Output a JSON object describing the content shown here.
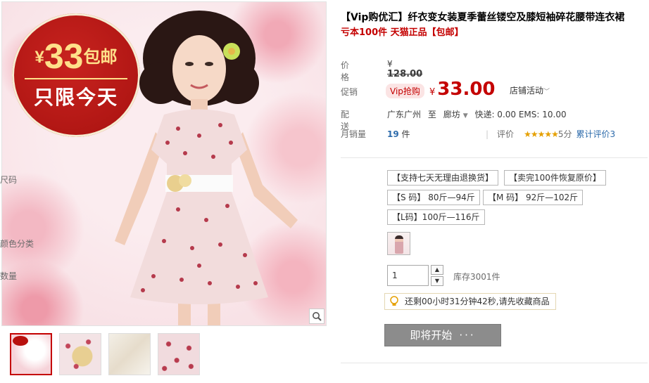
{
  "promo": {
    "currency": "¥",
    "price": "33",
    "tag": "包邮",
    "subline": "只限今天"
  },
  "product": {
    "title": "【Vip购优汇】纤衣变女装夏季蕾丝镂空及膝短袖碎花腰带连衣裙",
    "subtitle": "亏本100件 天猫正品【包邮】"
  },
  "price": {
    "label": "价格",
    "currency": "¥",
    "original": "128.00"
  },
  "promotion": {
    "label": "促销",
    "badge": "Vip抢购",
    "currency": "¥",
    "price": "33.00",
    "shop_activity": "店铺活动"
  },
  "shipping": {
    "label": "配送",
    "from": "广东广州",
    "to_word": "至",
    "dest": "廊坊",
    "fees": "快递: 0.00 EMS: 10.00"
  },
  "sales": {
    "label": "月销量",
    "count": "19",
    "unit": "件",
    "review_label": "评价",
    "stars": "★★★★★",
    "score": "5分",
    "review_link": "累计评价3"
  },
  "size": {
    "label": "尺码",
    "options": [
      "【支持七天无理由退换货】",
      "【卖完100件恢复原价】",
      "【S 码】 80斤—94斤",
      "【M 码】 92斤—102斤",
      "【L码】100斤—116斤"
    ]
  },
  "color": {
    "label": "颜色分类"
  },
  "quantity": {
    "label": "数量",
    "value": "1",
    "up": "▲",
    "down": "▼",
    "stock": "库存3001件"
  },
  "countdown": "还剩00小时31分钟42秒,请先收藏商品",
  "buy_button": {
    "label": "即将开始",
    "dots": "···"
  },
  "colors": {
    "accent": "#c40000",
    "link": "#2d6bab",
    "button_disabled": "#8c8c8c"
  }
}
